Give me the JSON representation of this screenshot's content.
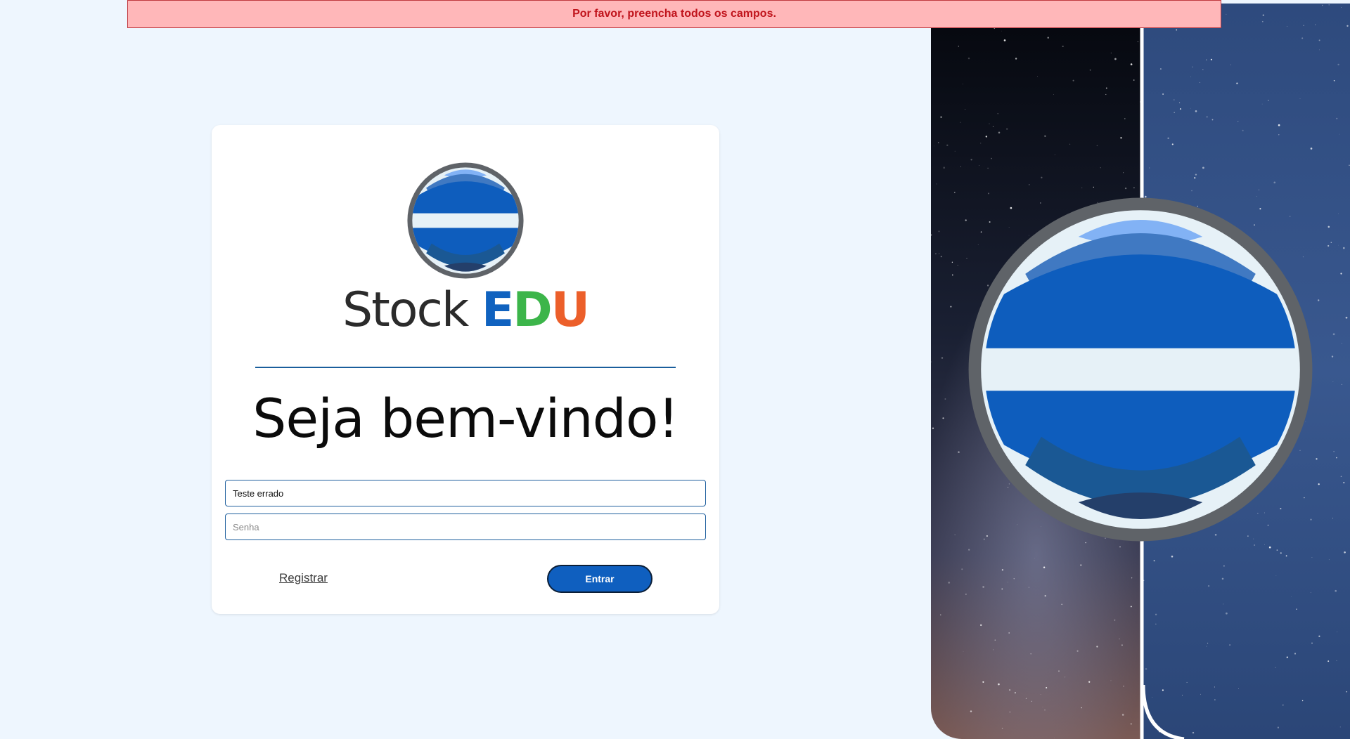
{
  "alert": {
    "message": "Por favor, preencha todos os campos."
  },
  "brand": {
    "name_part1": "Stock",
    "name_e": "E",
    "name_d": "D",
    "name_u": "U",
    "colors": {
      "stock": "#2b2b2b",
      "e": "#1062bf",
      "d": "#3cb54a",
      "u": "#ec5f2a"
    }
  },
  "welcome": {
    "title": "Seja bem-vindo!"
  },
  "form": {
    "username_value": "Teste errado",
    "password_placeholder": "Senha",
    "register_label": "Registrar",
    "login_label": "Entrar"
  },
  "colors": {
    "page_bg": "#eef6fe",
    "alert_bg": "#ffb7b9",
    "alert_text": "#c0141c",
    "primary": "#0f5fbf",
    "divider": "#1a5e9c"
  },
  "icons": {
    "logo": "globe-logo-icon",
    "hero": "globe-hero-icon"
  }
}
